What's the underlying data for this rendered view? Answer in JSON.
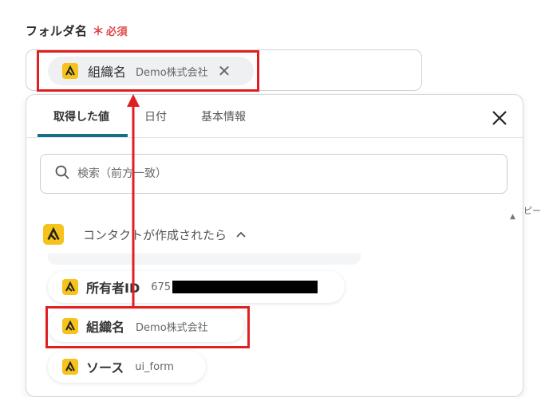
{
  "field": {
    "label": "フォルダ名",
    "required_star": "＊",
    "required_text": "必須"
  },
  "selected_token": {
    "label": "組織名",
    "value": "Demo株式会社",
    "remove_symbol": "✕"
  },
  "tabs": [
    {
      "label": "取得した値",
      "active": true
    },
    {
      "label": "日付",
      "active": false
    },
    {
      "label": "基本情報",
      "active": false
    }
  ],
  "search": {
    "placeholder": "検索（前方一致）"
  },
  "section": {
    "title": "コンタクトが作成されたら",
    "caret": "^"
  },
  "items": [
    {
      "label": "所有者ID",
      "value": "675"
    },
    {
      "label": "組織名",
      "value": "Demo株式会社"
    },
    {
      "label": "ソース",
      "value": "ui_form"
    }
  ],
  "peek_text": "ピー",
  "colors": {
    "accent": "#176f86",
    "highlight": "#e02020",
    "app_icon": "#f6c21c",
    "required": "#e04848"
  },
  "icons": {
    "app": "app-logo-icon",
    "search": "search-icon",
    "close": "close-icon",
    "remove": "remove-icon",
    "caret": "chevron-up-icon"
  }
}
